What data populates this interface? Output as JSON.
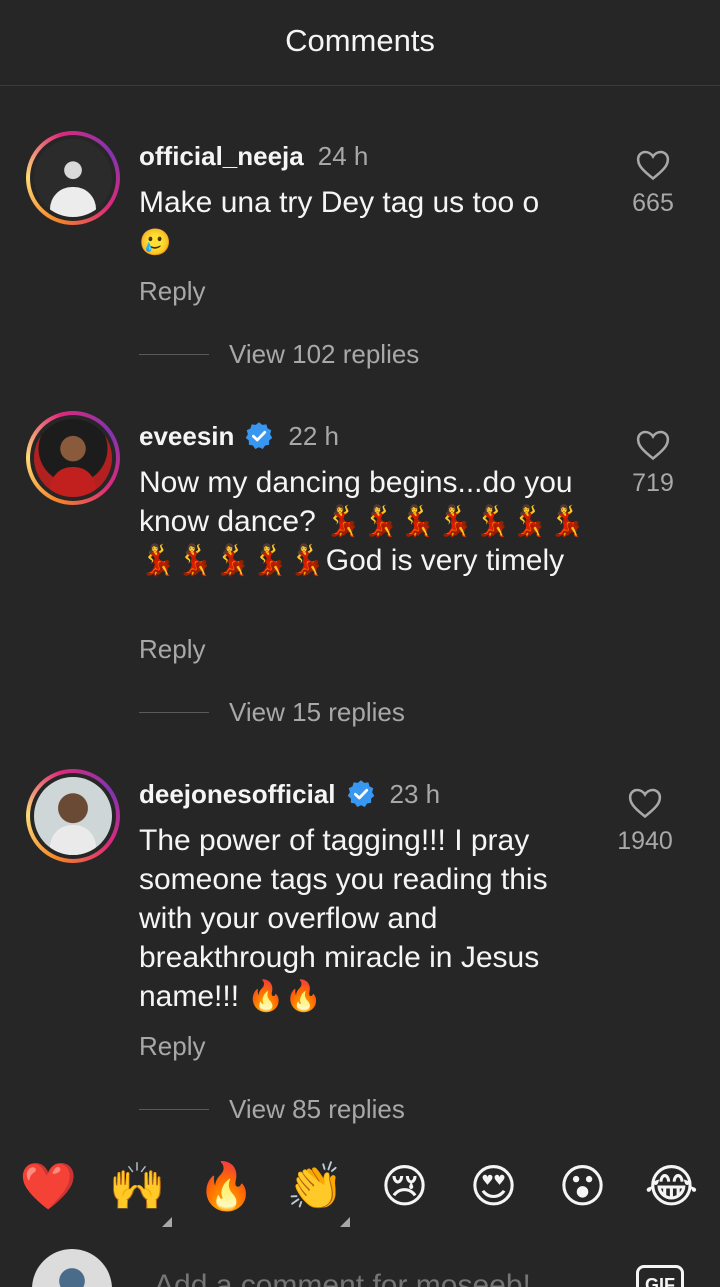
{
  "header": {
    "title": "Comments"
  },
  "comments": [
    {
      "username": "official_neeja",
      "verified": false,
      "time": "24 h",
      "text": "Make una try Dey tag us too o",
      "text_emoji": "🥲",
      "reply_label": "Reply",
      "view_replies": "View 102 replies",
      "likes": "665"
    },
    {
      "username": "eveesin",
      "verified": true,
      "time": "22 h",
      "text": "Now my dancing begins...do you know dance? 💃💃💃💃💃💃💃💃💃💃💃💃God is very timely",
      "reply_label": "Reply",
      "view_replies": "View 15 replies",
      "likes": "719"
    },
    {
      "username": "deejonesofficial",
      "verified": true,
      "time": "23 h",
      "text": "The power of tagging!!! I pray someone tags you reading this with your overflow and breakthrough miracle in Jesus name!!! 🔥🔥",
      "reply_label": "Reply",
      "view_replies": "View 85 replies",
      "likes": "1940"
    }
  ],
  "reactions": [
    "❤️",
    "🙌",
    "🔥",
    "👏",
    "😢",
    "😍",
    "😮",
    "😂"
  ],
  "composer": {
    "placeholder": "Add a comment for moseeb!",
    "gif_label": "GIF"
  },
  "colors": {
    "background": "#262626",
    "text_primary": "#f5f5f5",
    "text_secondary": "#a8a8a8",
    "verified": "#3897f0"
  },
  "icons": {
    "like": "heart-outline-icon",
    "verified": "verified-badge-icon"
  }
}
